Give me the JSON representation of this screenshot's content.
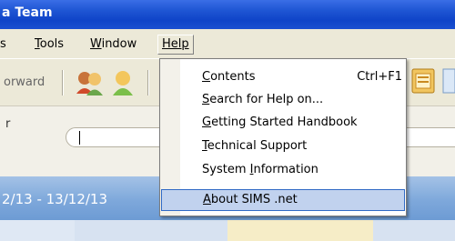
{
  "window": {
    "title": "a Team"
  },
  "menubar": {
    "items": [
      {
        "label": "s",
        "ul": ""
      },
      {
        "label": "Tools",
        "ul": "T"
      },
      {
        "label": "Window",
        "ul": "W"
      },
      {
        "label": "Help",
        "ul": "H"
      }
    ]
  },
  "toolbar": {
    "forward_label": "orward"
  },
  "panel": {
    "label": "r"
  },
  "date_range": "2/13 - 13/12/13",
  "help_menu": {
    "items": [
      {
        "pre": "",
        "ul": "C",
        "post": "ontents",
        "shortcut": "Ctrl+F1"
      },
      {
        "pre": "",
        "ul": "S",
        "post": "earch for Help on...",
        "shortcut": ""
      },
      {
        "pre": "",
        "ul": "G",
        "post": "etting Started Handbook",
        "shortcut": ""
      },
      {
        "pre": "",
        "ul": "T",
        "post": "echnical Support",
        "shortcut": ""
      },
      {
        "pre": "System ",
        "ul": "I",
        "post": "nformation",
        "shortcut": ""
      },
      {
        "pre": "",
        "ul": "A",
        "post": "bout SIMS .net",
        "shortcut": ""
      }
    ]
  },
  "colors": {
    "title_blue": "#1f56d4",
    "menu_highlight": "#c1d2ee",
    "highlight_border": "#316ac5"
  }
}
